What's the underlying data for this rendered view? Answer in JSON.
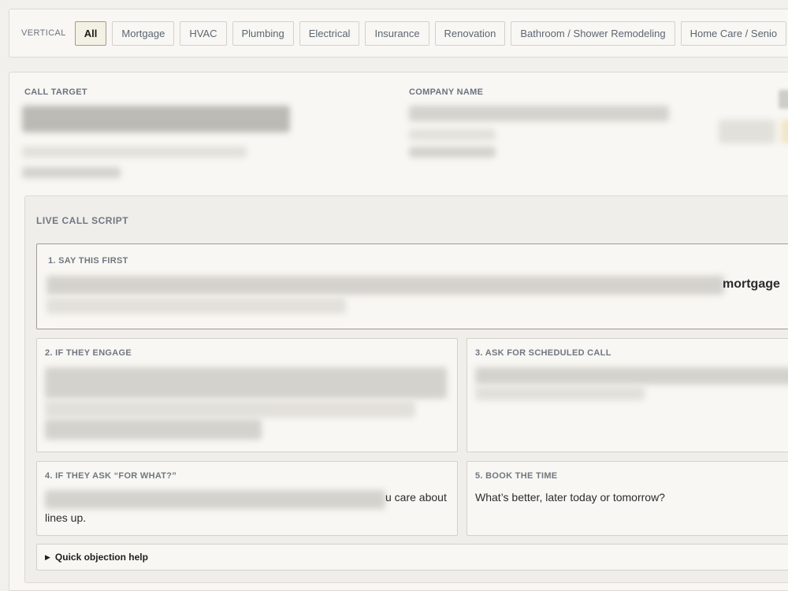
{
  "vertical_filter": {
    "label": "VERTICAL",
    "chips": [
      {
        "label": "All",
        "active": true
      },
      {
        "label": "Mortgage",
        "active": false
      },
      {
        "label": "HVAC",
        "active": false
      },
      {
        "label": "Plumbing",
        "active": false
      },
      {
        "label": "Electrical",
        "active": false
      },
      {
        "label": "Insurance",
        "active": false
      },
      {
        "label": "Renovation",
        "active": false
      },
      {
        "label": "Bathroom / Shower Remodeling",
        "active": false
      },
      {
        "label": "Home Care / Senio",
        "active": false
      }
    ]
  },
  "target": {
    "call_target_label": "CALL TARGET",
    "company_name_label": "COMPANY NAME"
  },
  "script": {
    "title": "LIVE CALL SCRIPT",
    "step1": {
      "label": "1. SAY THIS FIRST",
      "visible_text": "mortgage"
    },
    "step2": {
      "label": "2. IF THEY ENGAGE"
    },
    "step3": {
      "label": "3. ASK FOR SCHEDULED CALL"
    },
    "step4": {
      "label": "4. IF THEY ASK “FOR WHAT?”",
      "visible_tail": "u care about",
      "visible_line2": "lines up."
    },
    "step5": {
      "label": "5. BOOK THE TIME",
      "text": "What’s better, later today or tomorrow?"
    },
    "objection_toggle": "Quick objection help"
  },
  "colors": {
    "background": "#f1f0ec",
    "card": "#f8f7f3",
    "border": "#dcdad3",
    "label_gray": "#6b7380",
    "active_chip_bg": "#f3f1e3"
  }
}
